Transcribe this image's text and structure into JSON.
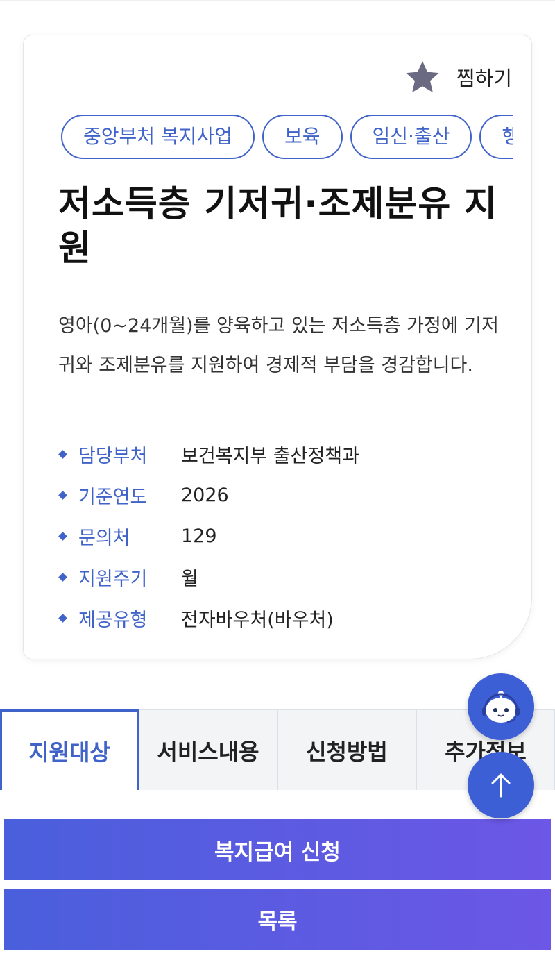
{
  "favorite": {
    "label": "찜하기",
    "icon": "star-icon"
  },
  "tags": [
    "중앙부처 복지사업",
    "보육",
    "임신·출산",
    "행정"
  ],
  "service": {
    "title": "저소득층 기저귀·조제분유 지원",
    "description": "영아(0~24개월)를 양육하고 있는 저소득층 가정에 기저귀와 조제분유를 지원하여 경제적 부담을 경감합니다."
  },
  "info": [
    {
      "key": "담당부처",
      "value": "보건복지부 출산정책과"
    },
    {
      "key": "기준연도",
      "value": "2026"
    },
    {
      "key": "문의처",
      "value": "129"
    },
    {
      "key": "지원주기",
      "value": "월"
    },
    {
      "key": "제공유형",
      "value": "전자바우처(바우처)"
    }
  ],
  "tabs": [
    {
      "label": "지원대상",
      "active": true
    },
    {
      "label": "서비스내용",
      "active": false
    },
    {
      "label": "신청방법",
      "active": false
    },
    {
      "label": "추가정보",
      "active": false
    }
  ],
  "buttons": {
    "apply": "복지급여 신청",
    "list": "목록"
  },
  "floating": {
    "chatbot_icon": "chatbot-icon",
    "top_icon": "arrow-up-icon"
  },
  "colors": {
    "accent": "#3f63c8",
    "gradient_start": "#4a5fdc",
    "gradient_end": "#6c57e6",
    "star": "#6a6a82"
  }
}
